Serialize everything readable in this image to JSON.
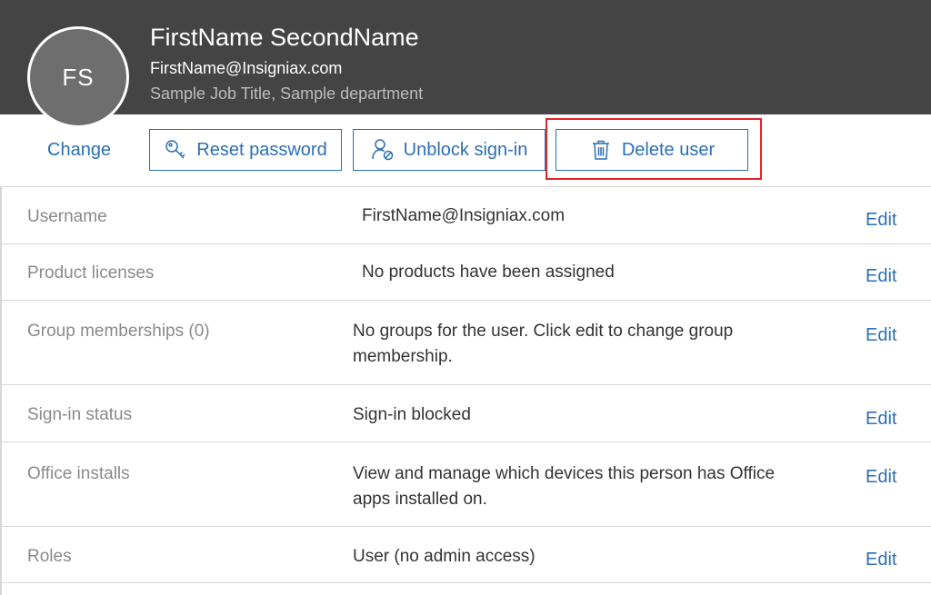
{
  "user": {
    "initials": "FS",
    "name": "FirstName SecondName",
    "email": "FirstName@Insigniax.com",
    "job": "Sample Job Title, Sample department"
  },
  "actions": {
    "change_label": "Change",
    "reset_password_label": "Reset password",
    "unblock_signin_label": "Unblock sign-in",
    "delete_user_label": "Delete user"
  },
  "rows": [
    {
      "label": "Username",
      "value": "FirstName@Insigniax.com",
      "edit": "Edit"
    },
    {
      "label": "Product licenses",
      "value": "No products have been assigned",
      "edit": "Edit"
    },
    {
      "label": "Group memberships (0)",
      "value": "No groups for the user. Click edit to change group membership.",
      "edit": "Edit"
    },
    {
      "label": "Sign-in status",
      "value": "Sign-in blocked",
      "edit": "Edit"
    },
    {
      "label": "Office installs",
      "value": "View and manage which devices this person has Office apps installed on.",
      "edit": "Edit"
    },
    {
      "label": "Roles",
      "value": "User (no admin access)",
      "edit": "Edit"
    }
  ],
  "colors": {
    "header_bg": "#444444",
    "accent": "#2b6fb5",
    "highlight": "#e0242a"
  },
  "icons": {
    "reset_password": "key-icon",
    "unblock_signin": "person-unblock-icon",
    "delete_user": "trash-icon"
  }
}
